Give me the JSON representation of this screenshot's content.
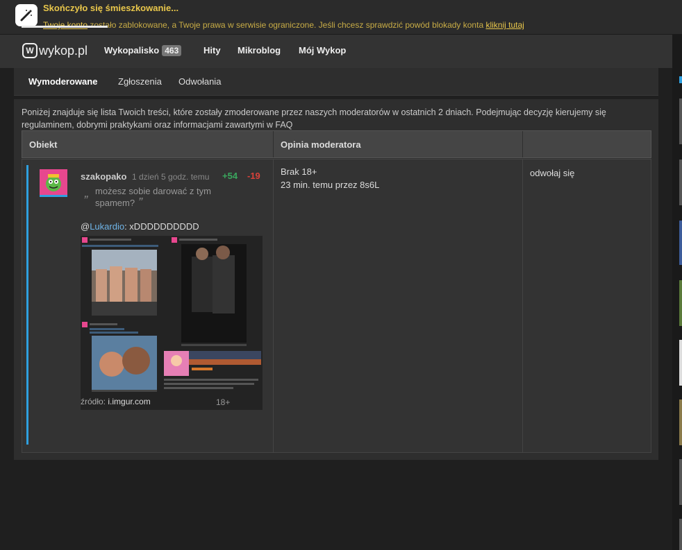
{
  "banner": {
    "title": "Skończyło się śmieszkowanie...",
    "link1": "Twoje konto",
    "msg_mid": " zostało zablokowane, a Twoje prawa w serwisie ograniczone. Jeśli chcesz sprawdzić powód blokady konta ",
    "link2": "kliknij tutaj"
  },
  "nav": {
    "logo": "wykop.pl",
    "items": [
      "Wykopalisko",
      "Hity",
      "Mikroblog",
      "Mój Wykop"
    ],
    "badge": "463"
  },
  "tabs": [
    "Wymoderowane",
    "Zgłoszenia",
    "Odwołania"
  ],
  "intro": "Poniżej znajduje się lista Twoich treści, które zostały zmoderowane przez naszych moderatorów w ostatnich 2 dniach. Podejmując decyzję kierujemy się regulaminem, dobrymi praktykami oraz informacjami zawartymi w FAQ",
  "table": {
    "headers": [
      "Obiekt",
      "Opinia moderatora",
      ""
    ],
    "row": {
      "author": "szakopako",
      "time": "1 dzień 5 godz. temu",
      "plus": "+54",
      "minus": "-19",
      "quote": "możesz sobie darować z tym spamem?",
      "mention_prefix": "@",
      "mention_user": "Lukardio",
      "mention_text": ": xDDDDDDDDDD",
      "source_label": "źródło: ",
      "source_domain": "i.imgur.com",
      "age_badge": "18+",
      "opinion_line1": "Brak 18+",
      "opinion_line2": "23 min. temu przez 8s6L",
      "action": "odwołaj się"
    }
  },
  "colors": {
    "accent_blue": "#2ea0e0",
    "plus_green": "#3aa75e",
    "minus_red": "#d9413a",
    "banner_yellow": "#e9c74b"
  }
}
